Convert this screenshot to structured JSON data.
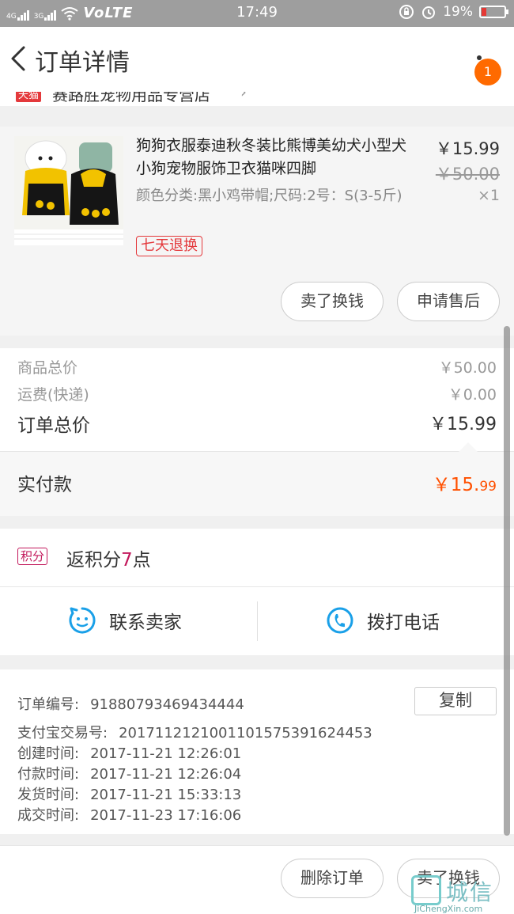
{
  "status_bar": {
    "signal1": "4G",
    "signal2": "3G",
    "network": "VoLTE",
    "time": "17:49",
    "battery": "19%"
  },
  "header": {
    "title": "订单详情",
    "badge_count": "1"
  },
  "shop": {
    "tmall_label": "天猫",
    "name": "赛路胜宠物用品专营店"
  },
  "product": {
    "title": "狗狗衣服泰迪秋冬装比熊博美幼犬小型犬小狗宠物服饰卫衣猫咪四脚",
    "sku": "颜色分类:黑小鸡带帽;尺码:2号：S(3-5斤)",
    "tag": "七天退换",
    "price": "￥15.99",
    "original_price": "￥50.00",
    "quantity": "×1",
    "sell_button": "卖了换钱",
    "aftersale_button": "申请售后"
  },
  "totals": {
    "goods_label": "商品总价",
    "goods_value": "￥50.00",
    "shipping_label": "运费(快递)",
    "shipping_value": "￥0.00",
    "order_total_label": "订单总价",
    "order_total_value": "￥15.99",
    "paid_label": "实付款",
    "paid_value_main": "￥15.",
    "paid_value_cents": "99",
    "accent_color": "#ff5000"
  },
  "points": {
    "tag": "积分",
    "prefix": "返积分",
    "amount": "7",
    "suffix": "点"
  },
  "contact": {
    "seller_label": "联系卖家",
    "call_label": "拨打电话",
    "icon_color": "#1aa0e8"
  },
  "order_info": {
    "copy_button": "复制",
    "rows": [
      {
        "key": "订单编号:",
        "value": "91880793469434444"
      },
      {
        "key": "支付宝交易号:",
        "value": "2017112121001101575391624453"
      },
      {
        "key": "创建时间:",
        "value": "2017-11-21  12:26:01"
      },
      {
        "key": "付款时间:",
        "value": "2017-11-21  12:26:04"
      },
      {
        "key": "发货时间:",
        "value": "2017-11-21  15:33:13"
      },
      {
        "key": "成交时间:",
        "value": "2017-11-23  17:16:06"
      }
    ]
  },
  "footer": {
    "delete_button": "删除订单",
    "sell_button": "卖了换钱"
  },
  "watermark": {
    "chinese": "城信",
    "domain": "JiChengXin.com"
  }
}
